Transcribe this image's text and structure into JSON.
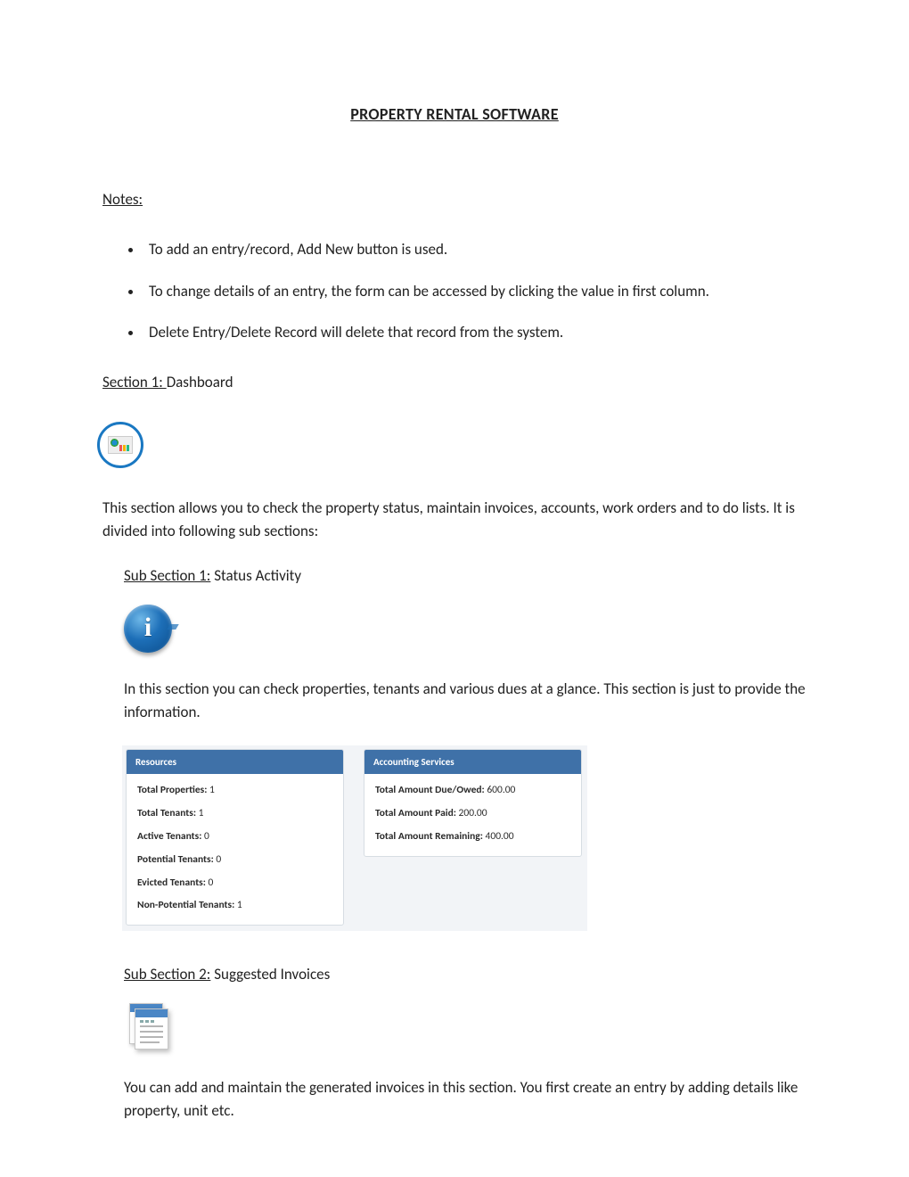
{
  "title": "PROPERTY RENTAL SOFTWARE",
  "notes": {
    "heading": "Notes:",
    "items": [
      "To add an entry/record, Add New button is used.",
      "To change details of an entry, the form can be accessed by clicking the value in first column.",
      "Delete Entry/Delete Record will delete that record from the system."
    ]
  },
  "section1": {
    "label": "Section 1: ",
    "name": "Dashboard",
    "description": "This section allows you to check the property status, maintain invoices, accounts, work orders and to do lists. It is divided into following sub sections:"
  },
  "sub1": {
    "label": "Sub Section 1:",
    "name": " Status Activity",
    "description": "In this section you can check properties, tenants and various dues at a glance. This section is just to provide the information.",
    "resources": {
      "header": "Resources",
      "rows": [
        {
          "label": "Total Properties:",
          "value": " 1"
        },
        {
          "label": "Total Tenants:",
          "value": " 1"
        },
        {
          "label": "Active Tenants:",
          "value": " 0"
        },
        {
          "label": "Potential Tenants:",
          "value": " 0"
        },
        {
          "label": "Evicted Tenants:",
          "value": " 0"
        },
        {
          "label": "Non-Potential Tenants:",
          "value": " 1"
        }
      ]
    },
    "accounting": {
      "header": "Accounting Services",
      "rows": [
        {
          "label": "Total Amount Due/Owed:",
          "value": " 600.00"
        },
        {
          "label": "Total Amount Paid:",
          "value": " 200.00"
        },
        {
          "label": "Total Amount Remaining:",
          "value": " 400.00"
        }
      ]
    }
  },
  "sub2": {
    "label": "Sub Section 2:",
    "name": " Suggested Invoices",
    "description": "You can add and maintain the generated invoices in this section. You first create an entry by adding details like property, unit etc."
  }
}
